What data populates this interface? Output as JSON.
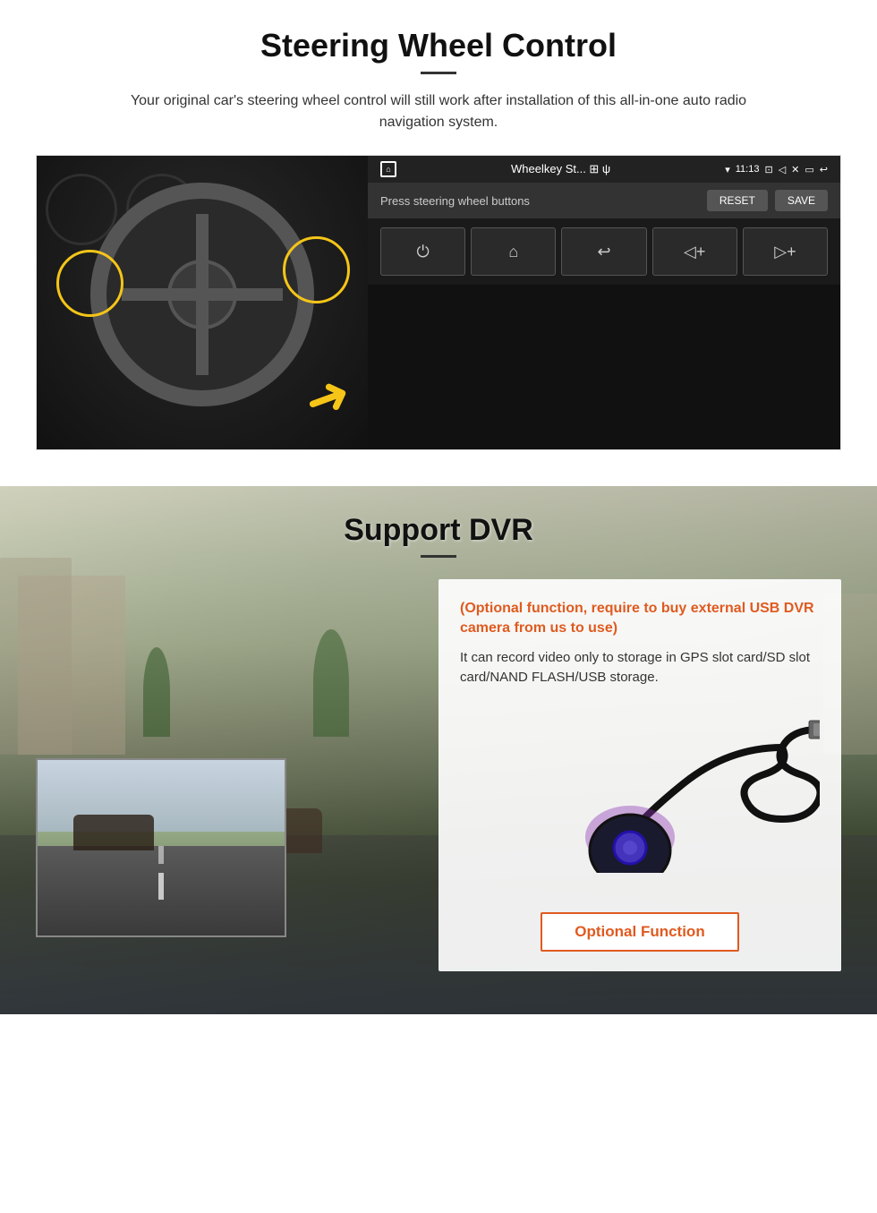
{
  "steering": {
    "title": "Steering Wheel Control",
    "description": "Your original car's steering wheel control will still work after installation of this all-in-one auto radio navigation system.",
    "android_ui": {
      "status_bar": {
        "home_icon": "⌂",
        "title": "Wheelkey St... ⊞ ψ",
        "wifi_icon": "▾",
        "time": "11:13",
        "camera_icon": "⊡",
        "volume_icon": "◁",
        "close_icon": "✕",
        "back_icon": "⤶",
        "return_icon": "↩"
      },
      "toolbar": {
        "label": "Press steering wheel buttons",
        "reset_btn": "RESET",
        "save_btn": "SAVE"
      },
      "buttons": [
        {
          "icon": "⏻",
          "label": "power"
        },
        {
          "icon": "⌂",
          "label": "home"
        },
        {
          "icon": "↩",
          "label": "back"
        },
        {
          "icon": "◁+",
          "label": "vol-down"
        },
        {
          "icon": "▷+",
          "label": "vol-up"
        }
      ]
    }
  },
  "dvr": {
    "title": "Support DVR",
    "info_title": "(Optional function, require to buy external USB DVR camera from us to use)",
    "info_text": "It can record video only to storage in GPS slot card/SD slot card/NAND FLASH/USB storage.",
    "optional_function_label": "Optional Function"
  }
}
